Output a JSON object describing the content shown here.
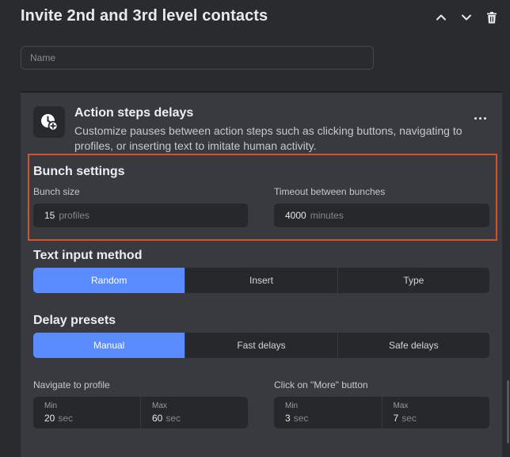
{
  "header": {
    "title": "Invite 2nd and 3rd level contacts",
    "icons": [
      "chevron-up-icon",
      "chevron-down-icon",
      "trash-icon"
    ]
  },
  "name_field": {
    "placeholder": "Name",
    "value": ""
  },
  "section": {
    "title": "Action steps delays",
    "description": "Customize pauses between action steps such as clicking buttons, navigating to profiles, or inserting text to imitate human activity.",
    "icon": "clock-plus-icon",
    "more_icon": "more-dots-icon"
  },
  "bunch": {
    "title": "Bunch settings",
    "highlight_color": "#d2512f",
    "size": {
      "label": "Bunch size",
      "value": "15",
      "unit": "profiles"
    },
    "timeout": {
      "label": "Timeout between bunches",
      "value": "4000",
      "unit": "minutes"
    }
  },
  "text_input": {
    "title": "Text input method",
    "options": [
      "Random",
      "Insert",
      "Type"
    ],
    "selected": "Random"
  },
  "delay_presets": {
    "title": "Delay presets",
    "options": [
      "Manual",
      "Fast delays",
      "Safe delays"
    ],
    "selected": "Manual"
  },
  "delays": [
    {
      "label": "Navigate to profile",
      "min": {
        "label": "Min",
        "value": "20",
        "unit": "sec"
      },
      "max": {
        "label": "Max",
        "value": "60",
        "unit": "sec"
      }
    },
    {
      "label": "Click on \"More\" button",
      "min": {
        "label": "Min",
        "value": "3",
        "unit": "sec"
      },
      "max": {
        "label": "Max",
        "value": "7",
        "unit": "sec"
      }
    }
  ],
  "colors": {
    "accent": "#5b8cff",
    "background": "#2a2b2f",
    "card": "#393a3f",
    "field": "#27282c"
  }
}
